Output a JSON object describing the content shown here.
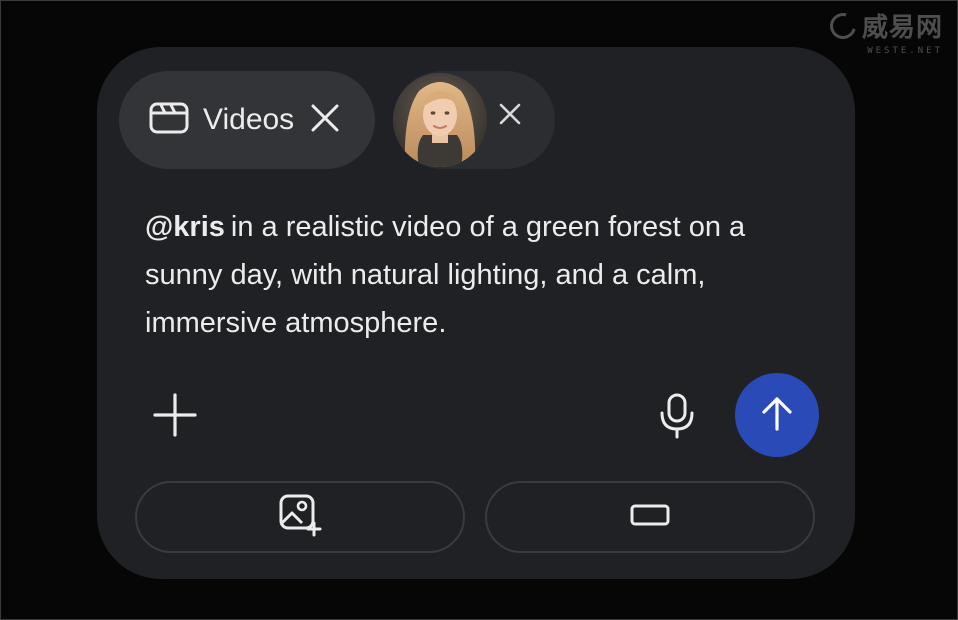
{
  "watermark": {
    "brand": "威易网",
    "url": "WESTE.NET"
  },
  "chips": {
    "videos_label": "Videos",
    "videos_icon": "clapperboard-icon",
    "videos_remove_icon": "close-icon",
    "person_remove_icon": "close-icon"
  },
  "prompt": {
    "mention": "@kris",
    "text": "in a realistic video of a green forest on a sunny day, with natural lighting, and a calm, immersive atmosphere."
  },
  "actions": {
    "add_icon": "plus-icon",
    "mic_icon": "microphone-icon",
    "send_icon": "arrow-up-icon",
    "add_image_icon": "image-add-icon",
    "aspect_ratio_icon": "aspect-ratio-landscape-icon"
  },
  "colors": {
    "background": "#060606",
    "panel": "#202124",
    "chip": "#333438",
    "text": "#ececec",
    "send_button": "#2a4ab8"
  }
}
